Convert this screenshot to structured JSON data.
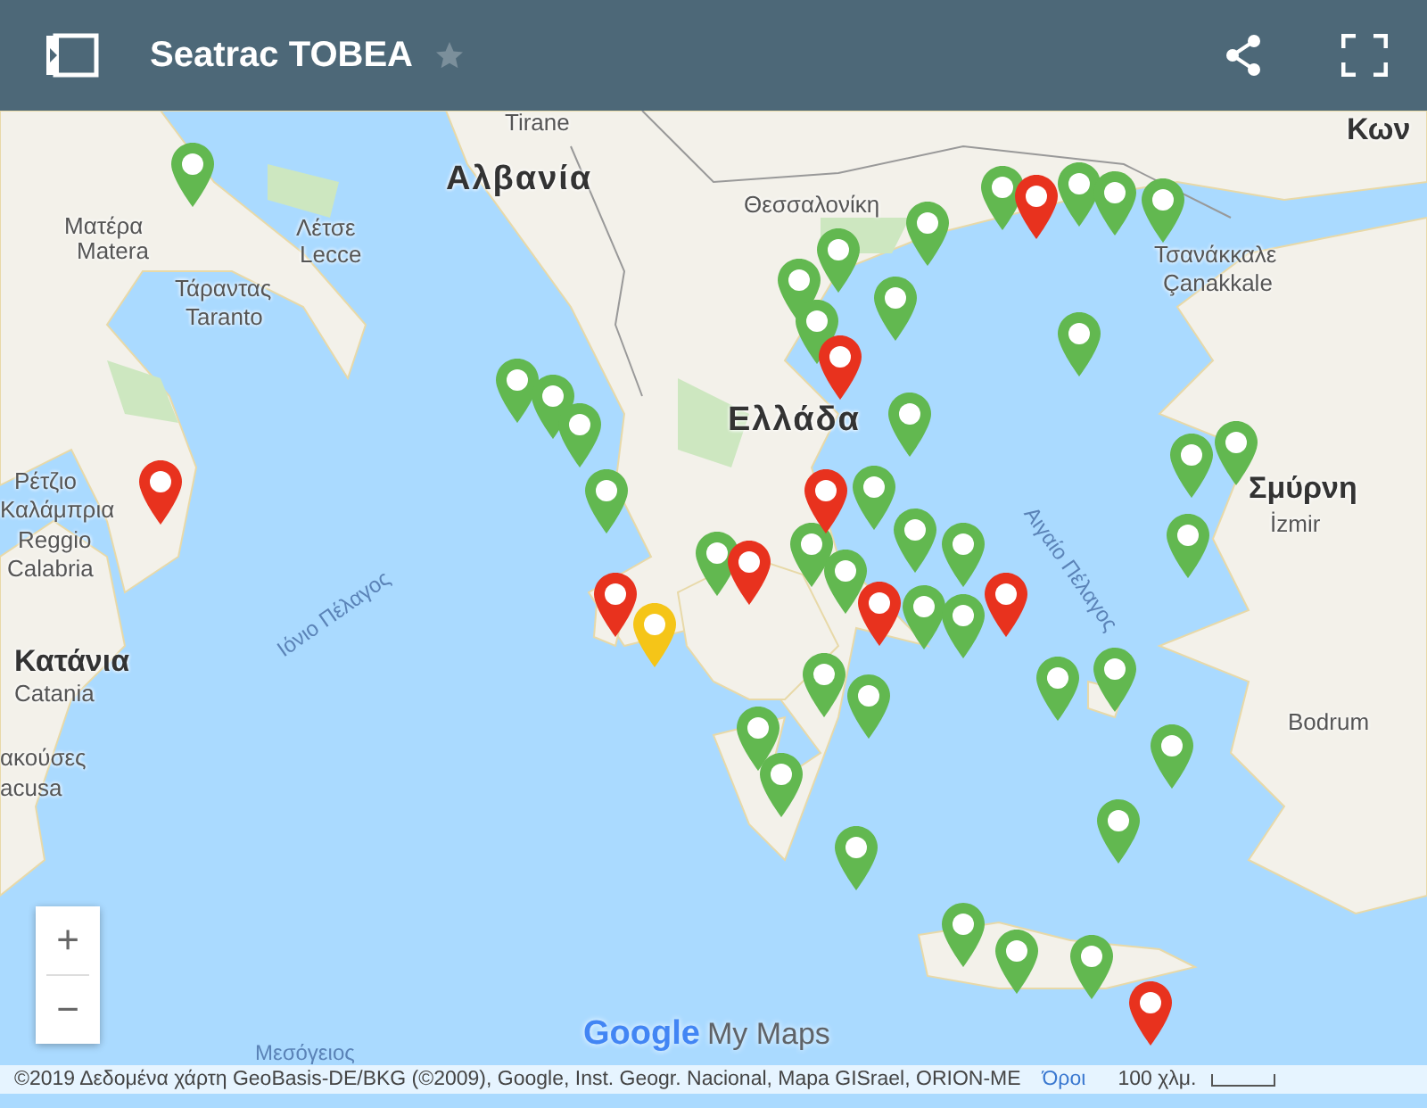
{
  "header": {
    "title": "Seatrac TOBEA",
    "starred": false
  },
  "map": {
    "labels": [
      {
        "text": "Tirane",
        "kind": "city"
      },
      {
        "text": "Αλβανία",
        "kind": "country"
      },
      {
        "text": "Ματέρα",
        "kind": "city"
      },
      {
        "text": "Matera",
        "kind": "city"
      },
      {
        "text": "Λέτσε",
        "kind": "city"
      },
      {
        "text": "Lecce",
        "kind": "city"
      },
      {
        "text": "Τάραντας",
        "kind": "city"
      },
      {
        "text": "Taranto",
        "kind": "city"
      },
      {
        "text": "Θεσσαλονίκη",
        "kind": "city"
      },
      {
        "text": "Τσανάκκαλε",
        "kind": "city"
      },
      {
        "text": "Çanakkale",
        "kind": "city"
      },
      {
        "text": "Ελλάδα",
        "kind": "country"
      },
      {
        "text": "Ρέτζιο",
        "kind": "city"
      },
      {
        "text": "Καλάμπρια",
        "kind": "city"
      },
      {
        "text": "Reggio",
        "kind": "city"
      },
      {
        "text": "Calabria",
        "kind": "city"
      },
      {
        "text": "Ιόνιο Πέλαγος",
        "kind": "sea"
      },
      {
        "text": "Κατάνια",
        "kind": "bigcity"
      },
      {
        "text": "Catania",
        "kind": "city"
      },
      {
        "text": "ακούσες",
        "kind": "city"
      },
      {
        "text": "acusa",
        "kind": "city"
      },
      {
        "text": "Αιγαίο Πέλαγος",
        "kind": "sea2"
      },
      {
        "text": "Σμύρνη",
        "kind": "bigcity"
      },
      {
        "text": "İzmir",
        "kind": "city"
      },
      {
        "text": "Bodrum",
        "kind": "city"
      },
      {
        "text": "Κων",
        "kind": "bigcity"
      },
      {
        "text": "Μεσόγειος",
        "kind": "sea3"
      }
    ],
    "pins": [
      {
        "color": "#62b850"
      },
      {
        "color": "#62b850"
      },
      {
        "color": "#62b850"
      },
      {
        "color": "#62b850"
      },
      {
        "color": "#62b850"
      },
      {
        "color": "#e8321e"
      },
      {
        "color": "#e8321e"
      },
      {
        "color": "#f5c518"
      },
      {
        "color": "#62b850"
      },
      {
        "color": "#e8321e"
      },
      {
        "color": "#62b850"
      },
      {
        "color": "#62b850"
      },
      {
        "color": "#62b850"
      },
      {
        "color": "#62b850"
      },
      {
        "color": "#e8321e"
      },
      {
        "color": "#62b850"
      },
      {
        "color": "#62b850"
      },
      {
        "color": "#62b850"
      },
      {
        "color": "#62b850"
      },
      {
        "color": "#e8321e"
      },
      {
        "color": "#62b850"
      },
      {
        "color": "#62b850"
      },
      {
        "color": "#62b850"
      },
      {
        "color": "#62b850"
      },
      {
        "color": "#e8321e"
      },
      {
        "color": "#62b850"
      },
      {
        "color": "#62b850"
      },
      {
        "color": "#62b850"
      },
      {
        "color": "#62b850"
      },
      {
        "color": "#e8321e"
      },
      {
        "color": "#62b850"
      },
      {
        "color": "#e8321e"
      },
      {
        "color": "#62b850"
      },
      {
        "color": "#62b850"
      },
      {
        "color": "#62b850"
      },
      {
        "color": "#62b850"
      },
      {
        "color": "#62b850"
      },
      {
        "color": "#62b850"
      },
      {
        "color": "#62b850"
      },
      {
        "color": "#62b850"
      },
      {
        "color": "#62b850"
      },
      {
        "color": "#62b850"
      },
      {
        "color": "#62b850"
      },
      {
        "color": "#62b850"
      },
      {
        "color": "#62b850"
      },
      {
        "color": "#e8321e"
      },
      {
        "color": "#62b850"
      },
      {
        "color": "#62b850"
      },
      {
        "color": "#62b850"
      }
    ],
    "zoom_in": "+",
    "zoom_out": "−",
    "logo": {
      "google": "Google",
      "product": "My Maps"
    },
    "attribution": "©2019 Δεδομένα χάρτη GeoBasis-DE/BKG (©2009), Google, Inst. Geogr. Nacional, Mapa GISrael, ORION-ME",
    "terms_link": "Όροι",
    "scale": "100 χλμ."
  }
}
